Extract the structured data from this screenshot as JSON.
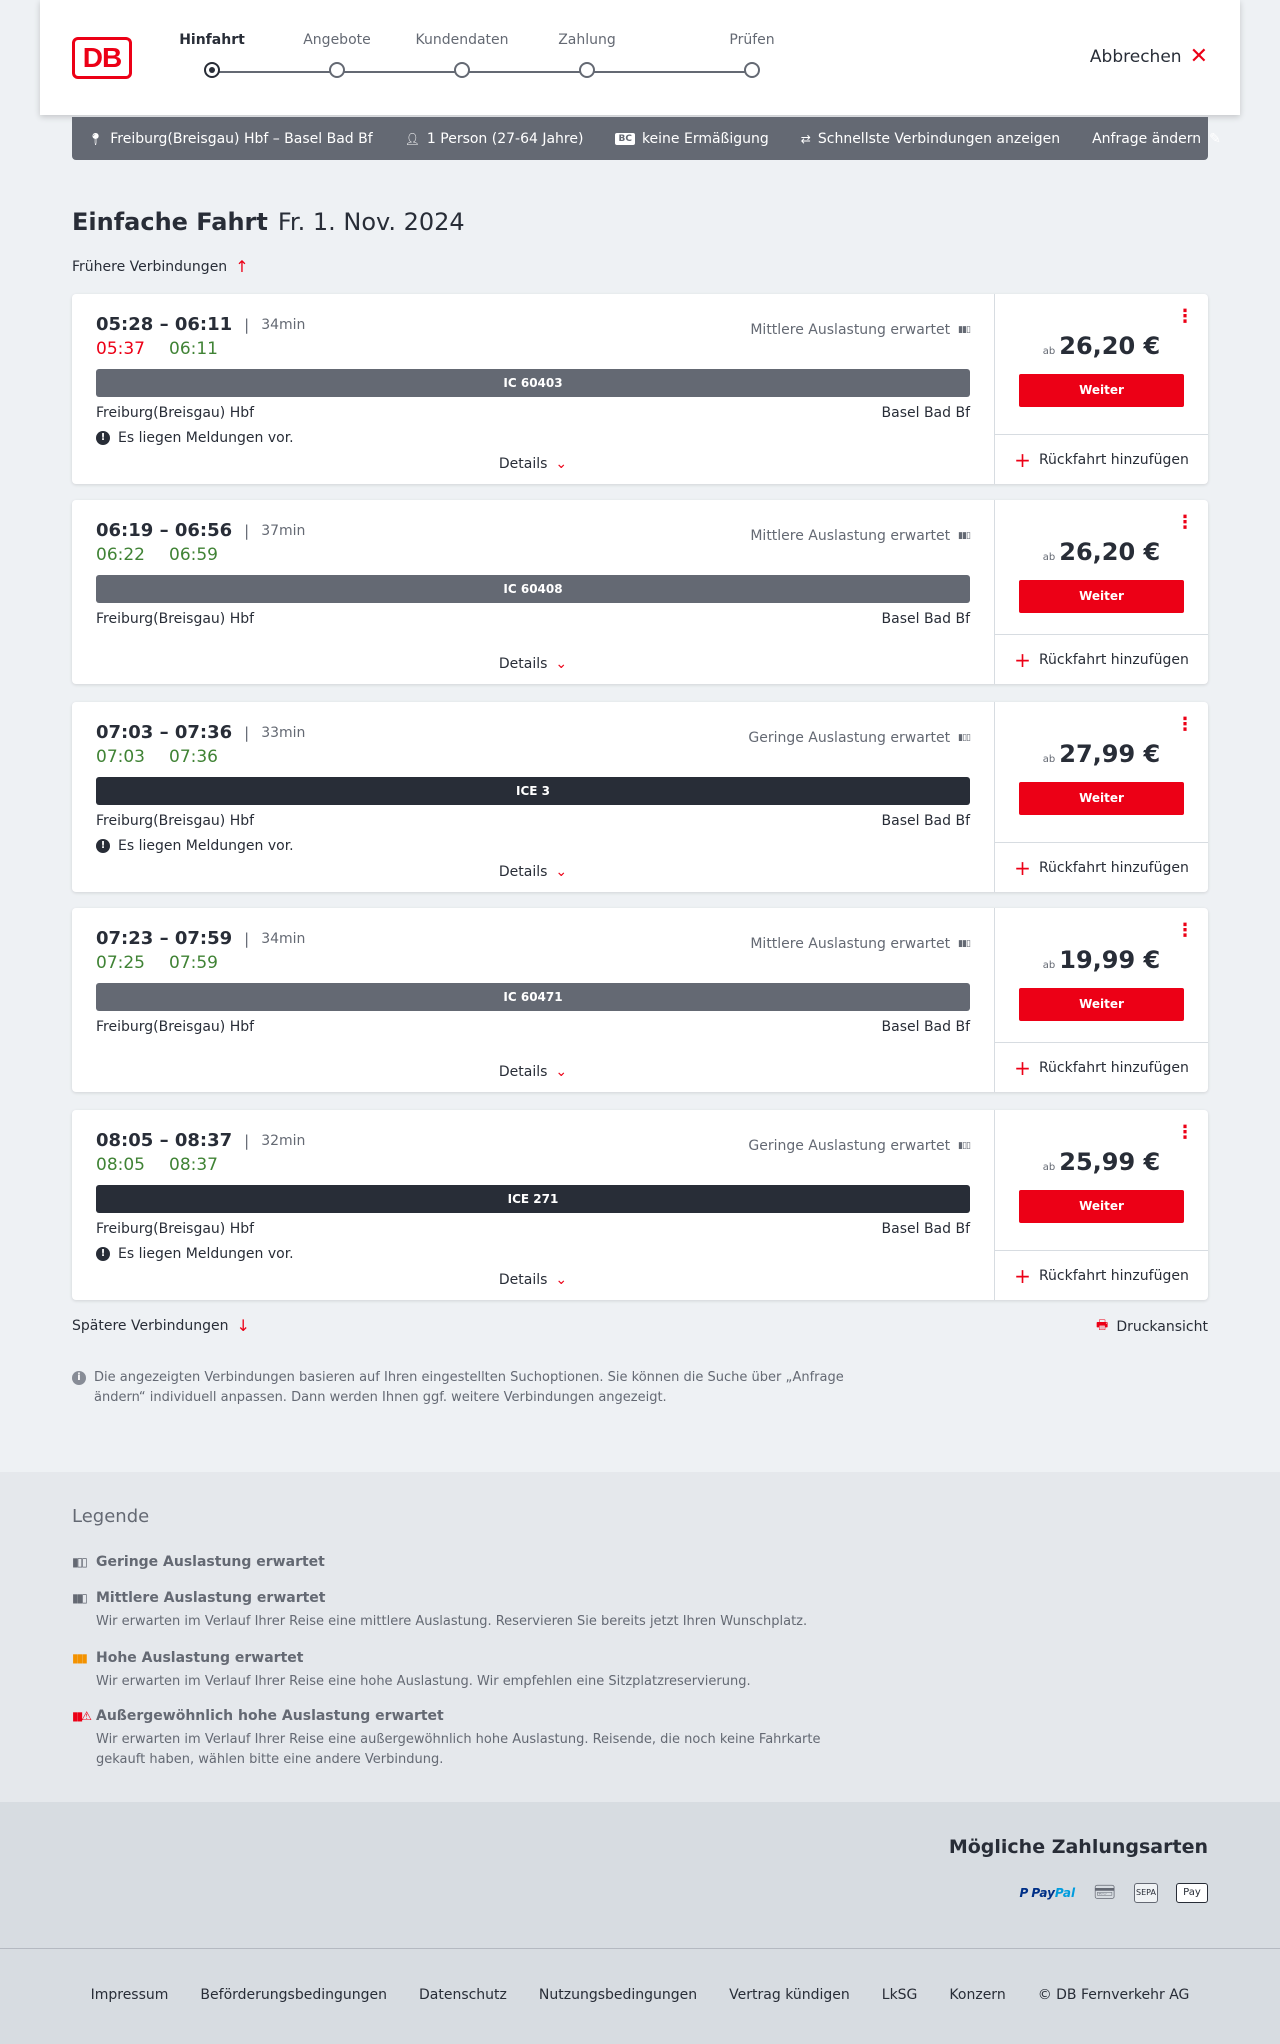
{
  "header": {
    "logo": "DB",
    "steps": [
      {
        "label": "Hinfahrt",
        "active": true
      },
      {
        "label": "Angebote",
        "active": false
      },
      {
        "label": "Kundendaten",
        "active": false
      },
      {
        "label": "Zahlung",
        "active": false
      },
      {
        "label": "Prüfen",
        "active": false
      }
    ],
    "cancel_label": "Abbrechen"
  },
  "search": {
    "route": "Freiburg(Breisgau) Hbf – Basel Bad Bf",
    "passengers": "1 Person (27-64 Jahre)",
    "discount_badge": "BC",
    "discount": "keine Ermäßigung",
    "fastest": "Schnellste Verbindungen anzeigen",
    "edit": "Anfrage ändern"
  },
  "main": {
    "title": "Einfache Fahrt",
    "date": "Fr. 1. Nov. 2024",
    "earlier": "Frühere Verbindungen",
    "later": "Spätere Verbindungen",
    "print": "Druckansicht",
    "info": "Die angezeigten Verbindungen basieren auf Ihren eingestellten Suchoptionen. Sie können die Suche über „Anfrage ändern“ individuell anpassen. Dann werden Ihnen ggf. weitere Verbindungen angezeigt."
  },
  "labels": {
    "details": "Details",
    "price_prefix": "ab",
    "continue": "Weiter",
    "add_return": "Rückfahrt hinzufügen",
    "messages": "Es liegen Meldungen vor."
  },
  "connections": [
    {
      "times": "05:28 – 06:11",
      "duration": "34min",
      "rt_dep": "05:37",
      "rt_arr": "06:11",
      "dep_late": true,
      "load": "Mittlere Auslastung erwartet",
      "load_level": 2,
      "train": "IC 60403",
      "train_type": "ic",
      "from": "Freiburg(Breisgau) Hbf",
      "to": "Basel Bad Bf",
      "has_messages": true,
      "price": "26,20 €"
    },
    {
      "times": "06:19 – 06:56",
      "duration": "37min",
      "rt_dep": "06:22",
      "rt_arr": "06:59",
      "dep_late": false,
      "load": "Mittlere Auslastung erwartet",
      "load_level": 2,
      "train": "IC 60408",
      "train_type": "ic",
      "from": "Freiburg(Breisgau) Hbf",
      "to": "Basel Bad Bf",
      "has_messages": false,
      "price": "26,20 €"
    },
    {
      "times": "07:03 – 07:36",
      "duration": "33min",
      "rt_dep": "07:03",
      "rt_arr": "07:36",
      "dep_late": false,
      "load": "Geringe Auslastung erwartet",
      "load_level": 1,
      "train": "ICE 3",
      "train_type": "ice",
      "from": "Freiburg(Breisgau) Hbf",
      "to": "Basel Bad Bf",
      "has_messages": true,
      "price": "27,99 €"
    },
    {
      "times": "07:23 – 07:59",
      "duration": "34min",
      "rt_dep": "07:25",
      "rt_arr": "07:59",
      "dep_late": false,
      "load": "Mittlere Auslastung erwartet",
      "load_level": 2,
      "train": "IC 60471",
      "train_type": "ic",
      "from": "Freiburg(Breisgau) Hbf",
      "to": "Basel Bad Bf",
      "has_messages": false,
      "price": "19,99 €"
    },
    {
      "times": "08:05 – 08:37",
      "duration": "32min",
      "rt_dep": "08:05",
      "rt_arr": "08:37",
      "dep_late": false,
      "load": "Geringe Auslastung erwartet",
      "load_level": 1,
      "train": "ICE 271",
      "train_type": "ice",
      "from": "Freiburg(Breisgau) Hbf",
      "to": "Basel Bad Bf",
      "has_messages": true,
      "price": "25,99 €"
    }
  ],
  "legend": {
    "title": "Legende",
    "items": [
      {
        "title": "Geringe Auslastung erwartet",
        "desc": "",
        "color": "#646973"
      },
      {
        "title": "Mittlere Auslastung erwartet",
        "desc": "Wir erwarten im Verlauf Ihrer Reise eine mittlere Auslastung. Reservieren Sie bereits jetzt Ihren Wunschplatz.",
        "color": "#646973"
      },
      {
        "title": "Hohe Auslastung erwartet",
        "desc": "Wir erwarten im Verlauf Ihrer Reise eine hohe Auslastung. Wir empfehlen eine Sitzplatzreservierung.",
        "color": "#f39200"
      },
      {
        "title": "Außergewöhnlich hohe Auslastung erwartet",
        "desc": "Wir erwarten im Verlauf Ihrer Reise eine außergewöhnlich hohe Auslastung. Reisende, die noch keine Fahrkarte gekauft haben, wählen bitte eine andere Verbindung.",
        "color": "#ec0016"
      }
    ]
  },
  "payment": {
    "title": "Mögliche Zahlungsarten",
    "paypal_a": "Pay",
    "paypal_b": "Pal",
    "sepa": "SEPA",
    "applepay": "Pay"
  },
  "footer": {
    "links": [
      "Impressum",
      "Beförderungsbedingungen",
      "Datenschutz",
      "Nutzungsbedingungen",
      "Vertrag kündigen",
      "LkSG",
      "Konzern",
      "© DB Fernverkehr AG"
    ]
  },
  "colors": {
    "accent": "#ec0016",
    "on_time": "#408335",
    "bar_ic": "#646973",
    "bar_ice": "#282d37"
  }
}
